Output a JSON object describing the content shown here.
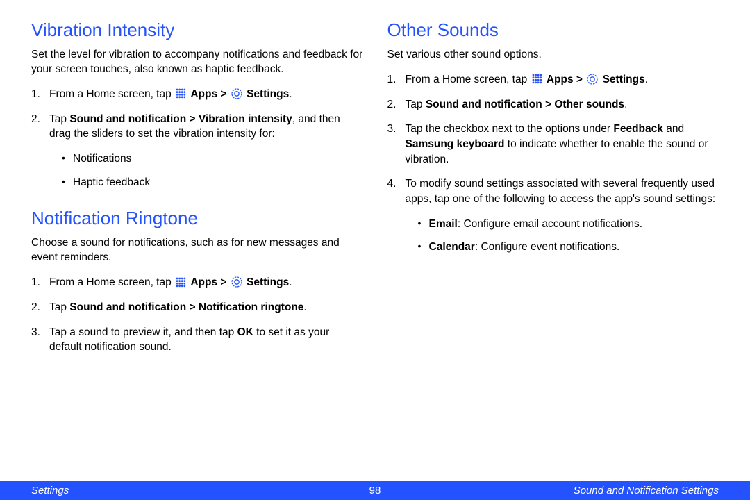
{
  "left": {
    "section1": {
      "heading": "Vibration Intensity",
      "intro": "Set the level for vibration to accompany notifications and feedback for your screen touches, also known as haptic feedback.",
      "step1_prefix": "From a Home screen, tap ",
      "step1_apps": "Apps > ",
      "step1_settings": "Settings",
      "step1_suffix": ".",
      "step2_prefix": "Tap ",
      "step2_bold": "Sound and notification > Vibration intensity",
      "step2_rest": ", and then drag the sliders to set the vibration intensity for:",
      "bullet1": "Notifications",
      "bullet2": "Haptic feedback"
    },
    "section2": {
      "heading": "Notification Ringtone",
      "intro": "Choose a sound for notifications, such as for new messages and event reminders.",
      "step1_prefix": "From a Home screen, tap ",
      "step1_apps": "Apps > ",
      "step1_settings": "Settings",
      "step1_suffix": ".",
      "step2_prefix": "Tap ",
      "step2_bold": "Sound and notification > Notification ringtone",
      "step2_suffix": ".",
      "step3_prefix": "Tap a sound to preview it, and then tap ",
      "step3_bold": "OK",
      "step3_rest": " to set it as your default notification sound."
    }
  },
  "right": {
    "section1": {
      "heading": "Other Sounds",
      "intro": "Set various other sound options.",
      "step1_prefix": "From a Home screen, tap ",
      "step1_apps": "Apps > ",
      "step1_settings": "Settings",
      "step1_suffix": ".",
      "step2_prefix": "Tap ",
      "step2_bold": "Sound and notification > Other sounds",
      "step2_suffix": ".",
      "step3_prefix": "Tap the checkbox next to the options under ",
      "step3_b1": "Feedback",
      "step3_mid": " and ",
      "step3_b2": "Samsung keyboard",
      "step3_rest": " to indicate whether to enable the sound or vibration.",
      "step4": "To modify sound settings associated with several frequently used apps, tap one of the following to access the app's sound settings:",
      "bullet1_b": "Email",
      "bullet1_rest": ": Configure email account notifications.",
      "bullet2_b": "Calendar",
      "bullet2_rest": ": Configure event notifications."
    }
  },
  "footer": {
    "left": "Settings",
    "center": "98",
    "right": "Sound and Notification Settings"
  }
}
